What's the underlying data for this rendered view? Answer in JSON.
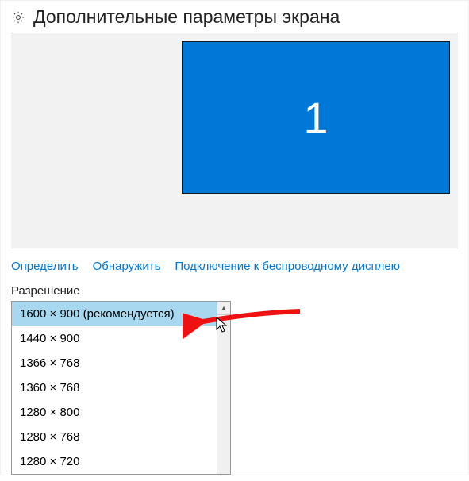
{
  "header": {
    "title": "Дополнительные параметры экрана"
  },
  "monitor": {
    "number": "1"
  },
  "links": {
    "identify": "Определить",
    "detect": "Обнаружить",
    "wireless": "Подключение к беспроводному дисплею"
  },
  "resolution": {
    "label": "Разрешение",
    "selected_index": 0,
    "options": [
      "1600 × 900 (рекомендуется)",
      "1440 × 900",
      "1366 × 768",
      "1360 × 768",
      "1280 × 800",
      "1280 × 768",
      "1280 × 720"
    ]
  },
  "colors": {
    "accent": "#0078d7",
    "highlight": "#a7d8ef",
    "panel": "#f2f2f2"
  }
}
